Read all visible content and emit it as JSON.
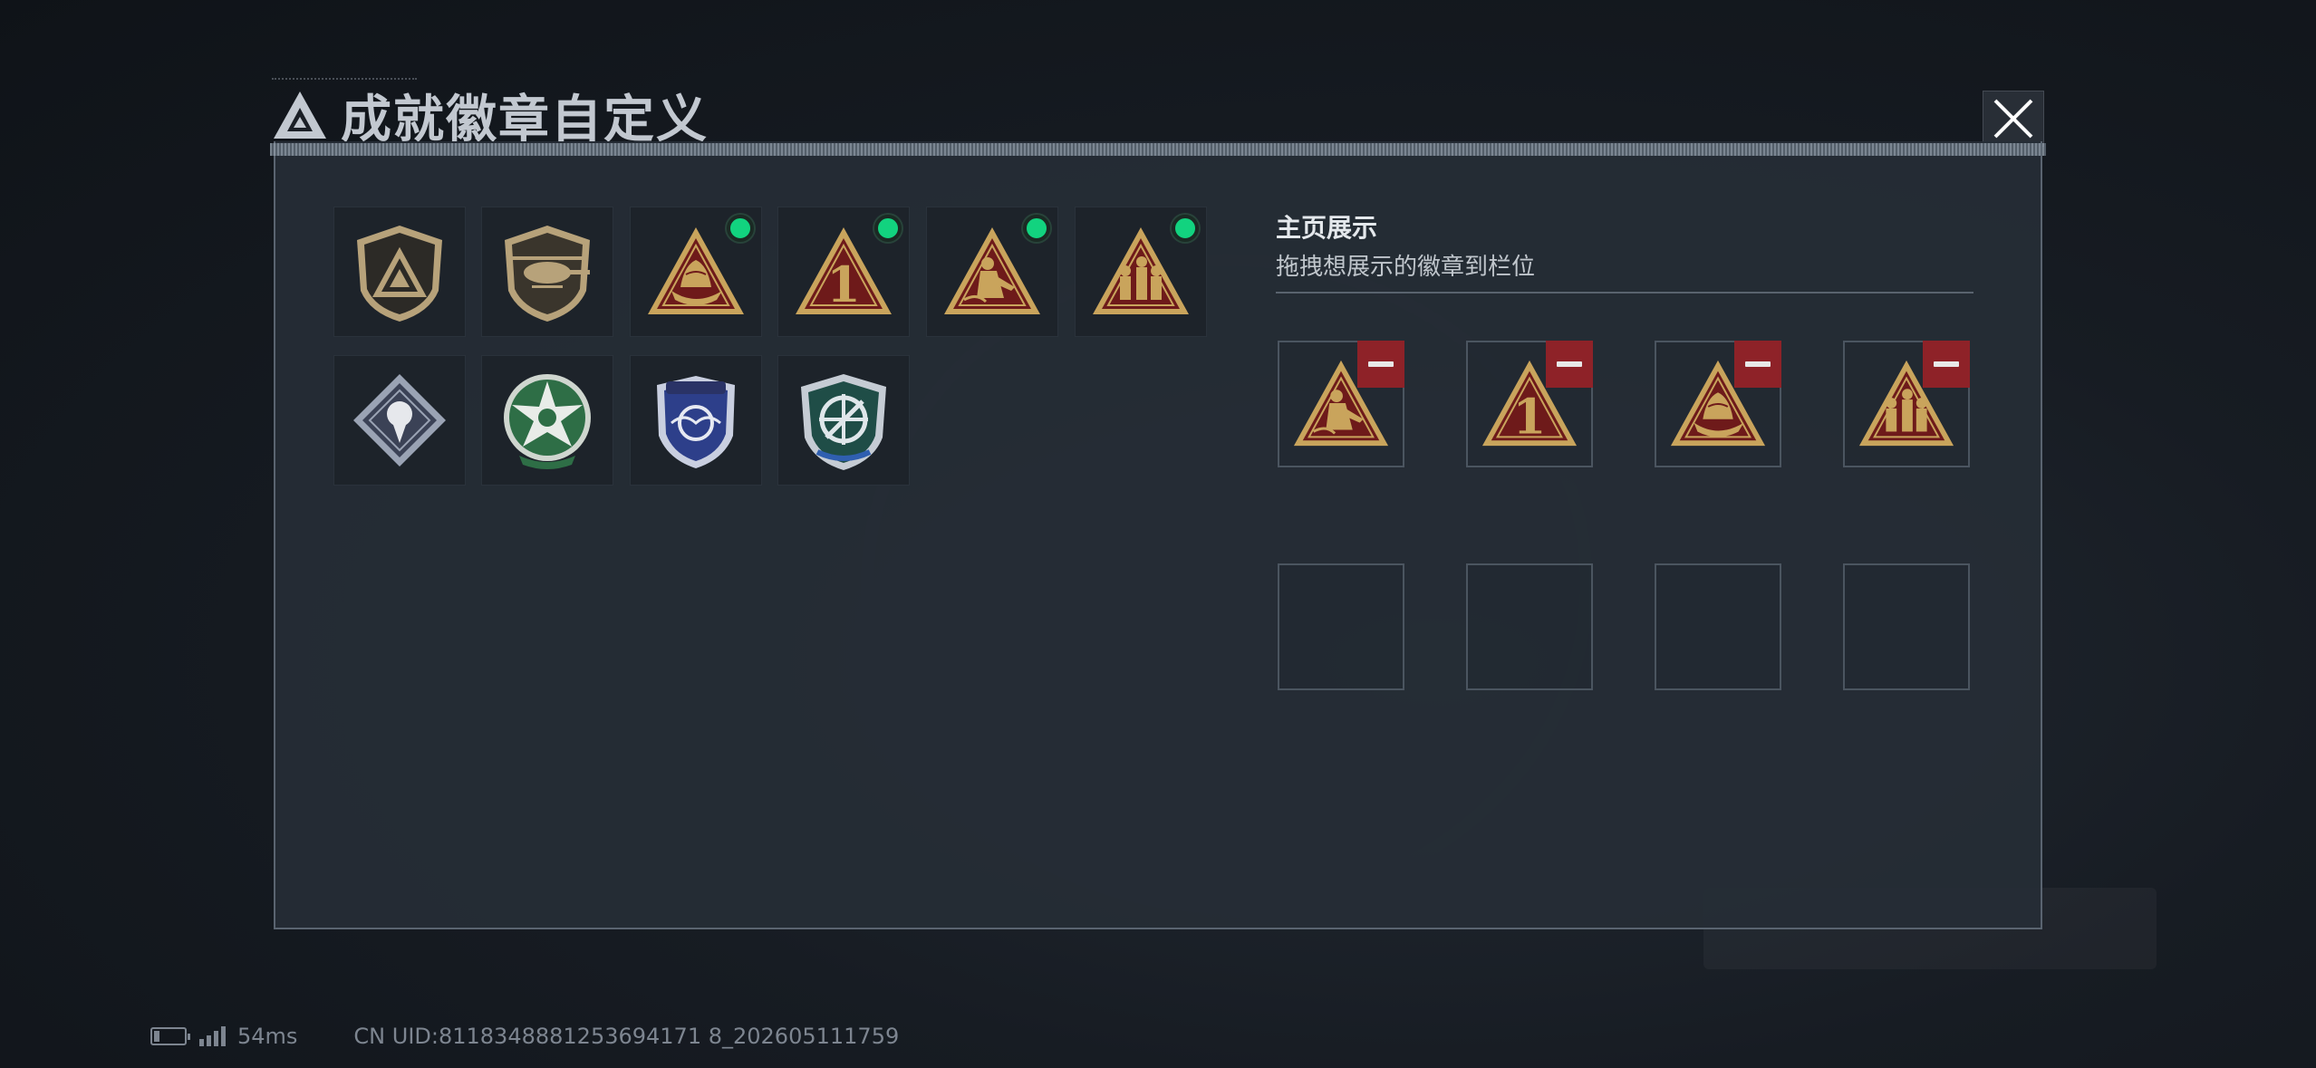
{
  "title": "成就徽章自定义",
  "showcase": {
    "title": "主页展示",
    "subtitle": "拖拽想展示的徽章到栏位"
  },
  "badges": [
    {
      "icon": "triangle-logo-shield-badge-icon",
      "equipped": false
    },
    {
      "icon": "helicopter-shield-badge-icon",
      "equipped": false
    },
    {
      "icon": "boat-triangle-badge-icon",
      "equipped": true
    },
    {
      "icon": "number-one-triangle-badge-icon",
      "equipped": true
    },
    {
      "icon": "soldier-triangle-badge-icon",
      "equipped": true
    },
    {
      "icon": "squad-triangle-badge-icon",
      "equipped": true
    },
    {
      "icon": "rose-diamond-badge-icon",
      "equipped": false
    },
    {
      "icon": "green-star-badge-icon",
      "equipped": false
    },
    {
      "icon": "blue-wing-shield-badge-icon",
      "equipped": false
    },
    {
      "icon": "crosshair-shield-badge-icon",
      "equipped": false
    }
  ],
  "slots": [
    {
      "icon": "soldier-triangle-badge-icon"
    },
    {
      "icon": "number-one-triangle-badge-icon"
    },
    {
      "icon": "boat-triangle-badge-icon"
    },
    {
      "icon": "squad-triangle-badge-icon"
    },
    {
      "icon": ""
    },
    {
      "icon": ""
    },
    {
      "icon": ""
    },
    {
      "icon": ""
    }
  ],
  "status": {
    "ping": "54ms",
    "uid": "CN UID:8118348881253694171 8_202605111759"
  },
  "colors": {
    "gold": "#c9a45c",
    "red_triangle": "#6e1a1a",
    "equipped_dot": "#12d37f",
    "remove_button": "#8e2228"
  }
}
